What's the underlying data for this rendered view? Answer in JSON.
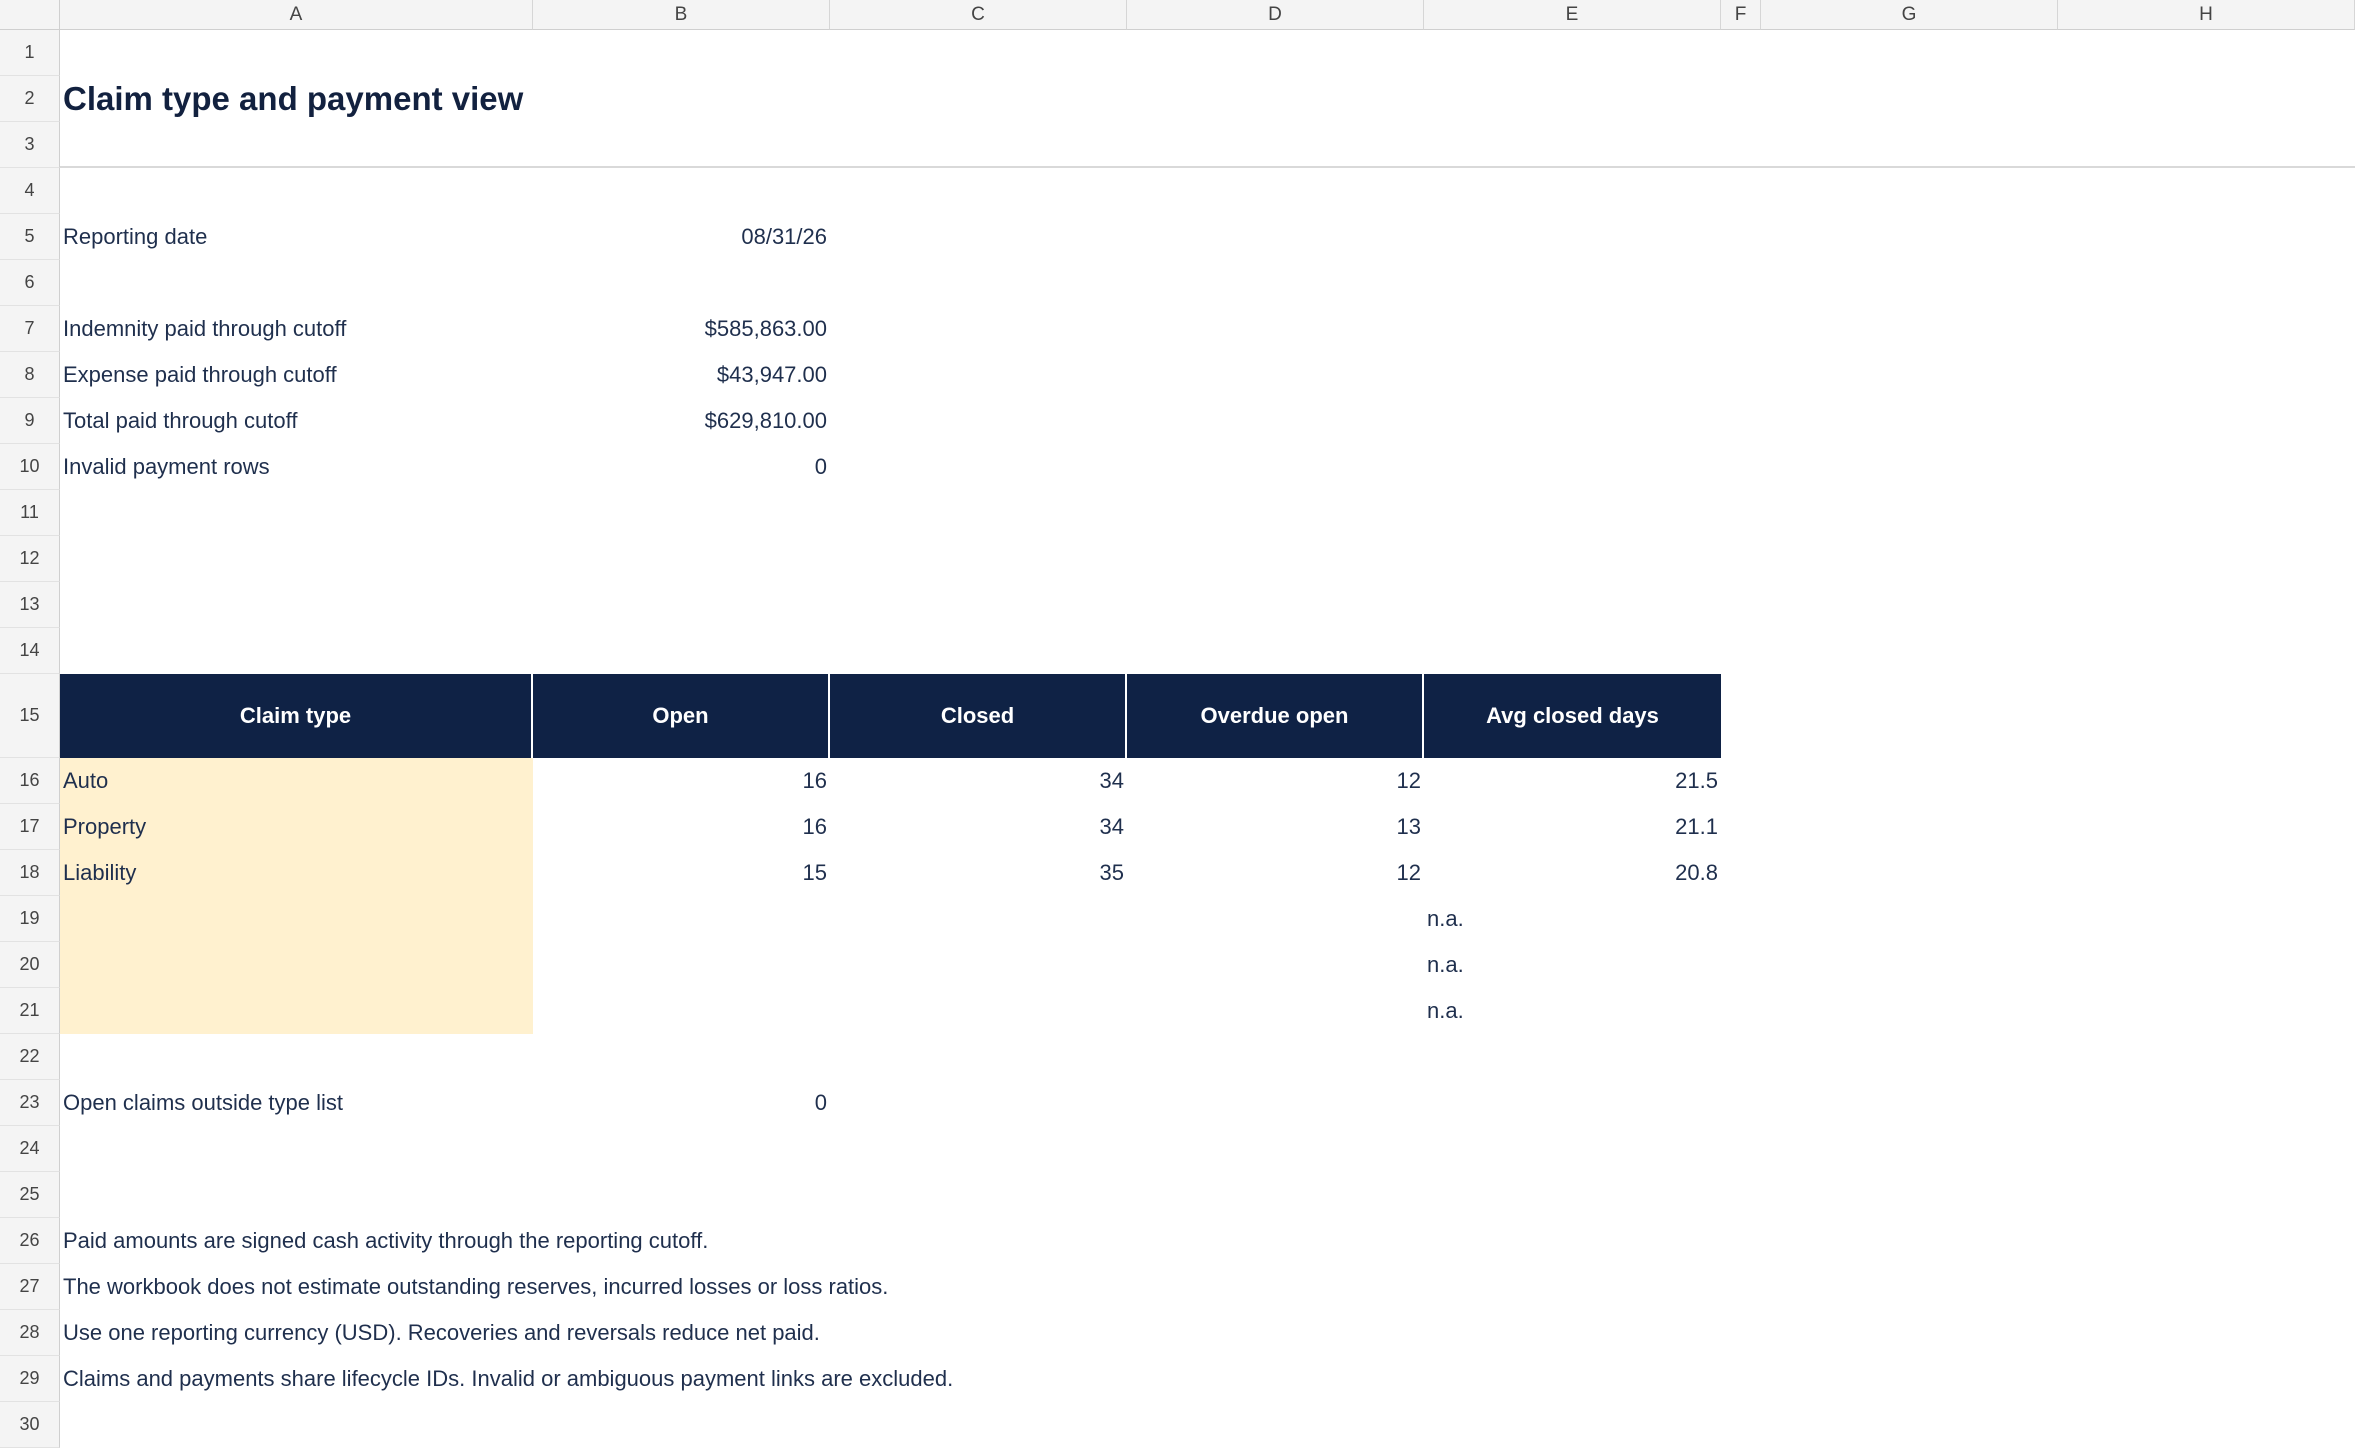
{
  "columns": [
    "A",
    "B",
    "C",
    "D",
    "E",
    "F",
    "G",
    "H"
  ],
  "rows": [
    "1",
    "2",
    "3",
    "4",
    "5",
    "6",
    "7",
    "8",
    "9",
    "10",
    "11",
    "12",
    "13",
    "14",
    "15",
    "16",
    "17",
    "18",
    "19",
    "20",
    "21",
    "22",
    "23",
    "24",
    "25",
    "26",
    "27",
    "28",
    "29",
    "30"
  ],
  "sheet": {
    "title": "Claim type and payment view",
    "reporting_date_label": "Reporting date",
    "reporting_date_value": "08/31/26",
    "summary": [
      {
        "label": "Indemnity paid through cutoff",
        "value": "$585,863.00"
      },
      {
        "label": "Expense paid through cutoff",
        "value": "$43,947.00"
      },
      {
        "label": "Total paid through cutoff",
        "value": "$629,810.00"
      },
      {
        "label": "Invalid payment rows",
        "value": "0"
      }
    ],
    "table": {
      "headers": [
        "Claim type",
        "Open",
        "Closed",
        "Overdue open",
        "Avg closed days"
      ],
      "rows": [
        {
          "type": "Auto",
          "open": "16",
          "closed": "34",
          "overdue": "12",
          "avg": "21.5"
        },
        {
          "type": "Property",
          "open": "16",
          "closed": "34",
          "overdue": "13",
          "avg": "21.1"
        },
        {
          "type": "Liability",
          "open": "15",
          "closed": "35",
          "overdue": "12",
          "avg": "20.8"
        },
        {
          "type": "",
          "open": "",
          "closed": "",
          "overdue": "",
          "avg": "n.a."
        },
        {
          "type": "",
          "open": "",
          "closed": "",
          "overdue": "",
          "avg": "n.a."
        },
        {
          "type": "",
          "open": "",
          "closed": "",
          "overdue": "",
          "avg": "n.a."
        }
      ]
    },
    "outside_label": "Open claims outside type list",
    "outside_value": "0",
    "notes": [
      "Paid amounts are signed cash activity through the reporting cutoff.",
      "The workbook does not estimate outstanding reserves, incurred losses or loss ratios.",
      "Use one reporting currency (USD). Recoveries and reversals reduce net paid.",
      "Claims and payments share lifecycle IDs. Invalid or ambiguous payment links are excluded."
    ]
  }
}
